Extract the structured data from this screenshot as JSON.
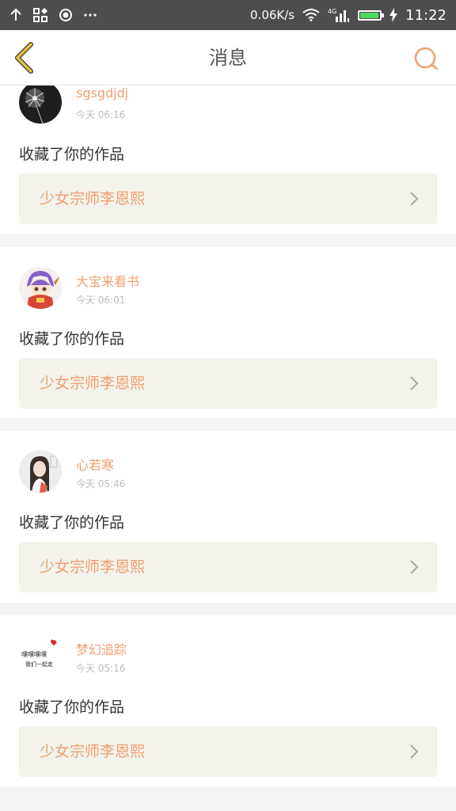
{
  "status_bar": {
    "network_speed": "0.06K/s",
    "time": "11:22",
    "signal_label": "4G",
    "battery_level": 0.95,
    "battery_color": "#4cd964"
  },
  "header": {
    "title": "消息",
    "back_icon": "chevron-left-icon",
    "search_icon": "search-icon"
  },
  "colors": {
    "accent": "#f0a070",
    "back_arrow": "#e6c23a",
    "work_box_bg": "#f3f3eb"
  },
  "messages": [
    {
      "user": "sgsgdjdj",
      "time": "今天 06:16",
      "action": "收藏了你的作品",
      "work_title": "少女宗师李恩熙",
      "avatar": "dandelion-avatar"
    },
    {
      "user": "大宝来看书",
      "time": "今天 06:01",
      "action": "收藏了你的作品",
      "work_title": "少女宗师李恩熙",
      "avatar": "anime-girl-avatar"
    },
    {
      "user": "心若寒",
      "time": "今天 05:46",
      "action": "收藏了你的作品",
      "work_title": "少女宗师李恩熙",
      "avatar": "portrait-avatar"
    },
    {
      "user": "梦幻追踪",
      "time": "今天 05:16",
      "action": "收藏了你的作品",
      "work_title": "少女宗师李恩熙",
      "avatar": "text-heart-avatar",
      "avatar_text_line1": "嘿嘿嘿嘿",
      "avatar_text_line2": "我们一起走"
    }
  ]
}
